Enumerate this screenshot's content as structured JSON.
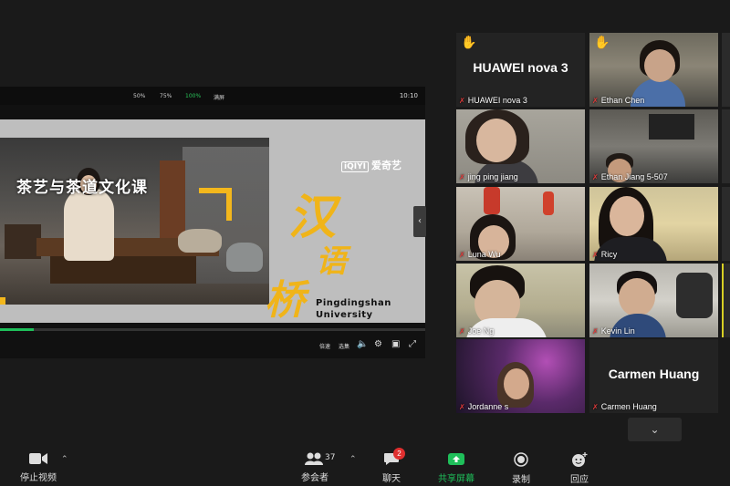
{
  "shared_video": {
    "speed_options": [
      "50%",
      "75%",
      "100%",
      "满屏"
    ],
    "active_option": "100%",
    "clock": "10:10",
    "photo_title": "茶艺与茶道文化课",
    "logo_mark": "iQIYI",
    "logo_text": "爱奇艺",
    "calligraphy": [
      "汉",
      "语",
      "桥"
    ],
    "university_line1": "Pingdingshan",
    "university_line2": "University",
    "progress": 0.08,
    "controls": [
      "倍速",
      "选集"
    ],
    "accent_color": "#1fbf5a",
    "brand_yellow": "#f0b419"
  },
  "participants": [
    {
      "name": "HUAWEI nova 3",
      "big_label": "HUAWEI nova 3",
      "hand_raised": true,
      "muted": true
    },
    {
      "name": "Ethan Chen",
      "hand_raised": true,
      "muted": true
    },
    {
      "name": "jing ping  jiang",
      "muted": true
    },
    {
      "name": "Ethan Jiang 5-507",
      "muted": true
    },
    {
      "name": "Luna Wu",
      "muted": true
    },
    {
      "name": "Ricy",
      "muted": true
    },
    {
      "name": "Joe Ng",
      "muted": true
    },
    {
      "name": "Kevin Lin",
      "muted": true
    },
    {
      "name": "Jordanne s",
      "muted": true
    },
    {
      "name": "Carmen Huang",
      "big_label": "Carmen Huang",
      "muted": true
    }
  ],
  "toolbar": {
    "video_label": "停止视频",
    "participants_label": "参会者",
    "participants_count": "37",
    "chat_label": "聊天",
    "chat_badge": "2",
    "share_label": "共享屏幕",
    "record_label": "录制",
    "reactions_label": "回应",
    "share_color": "#1fbf5a"
  }
}
